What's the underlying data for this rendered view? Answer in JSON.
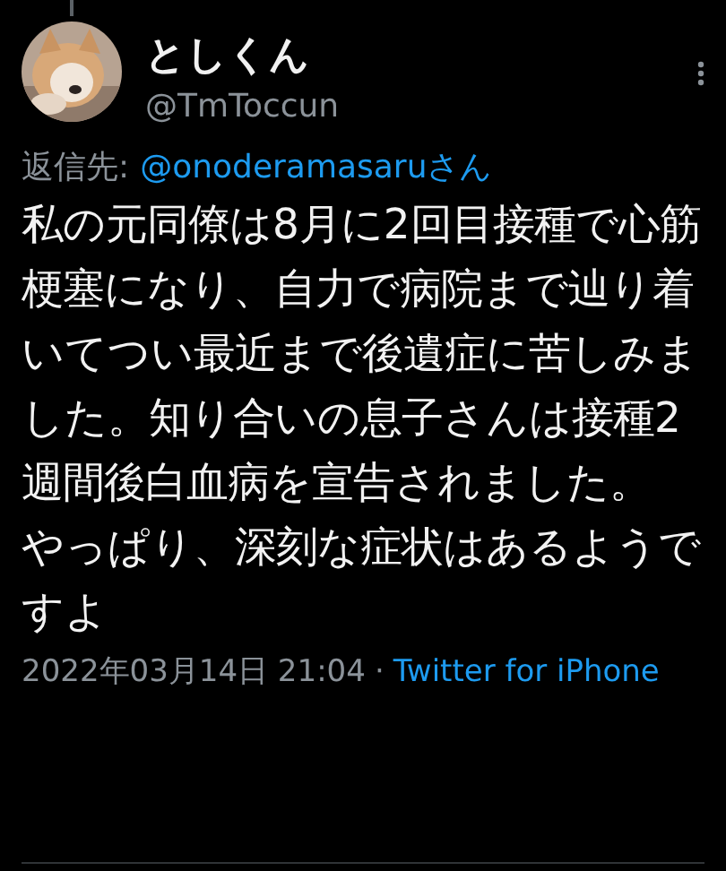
{
  "author": {
    "name": "としくん",
    "handle": "@TmToccun"
  },
  "reply_to": {
    "label": "返信先:",
    "mention": "@onoderamasaruさん"
  },
  "body": [
    "私の元同僚は8月に2回目接種で心筋梗塞になり、自力で病院まで辿り着いてつい最近まで後遺症に苦しみました。知り合いの息子さんは接種2週間後白血病を宣告されました。",
    "やっぱり、深刻な症状はあるようですよ"
  ],
  "meta": {
    "timestamp": "2022年03月14日 21:04",
    "separator": "·",
    "source": "Twitter for iPhone"
  }
}
